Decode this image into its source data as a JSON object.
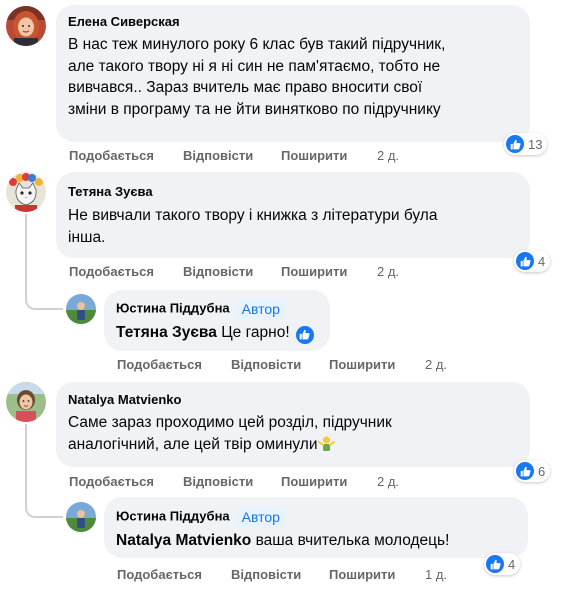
{
  "actions": {
    "like": "Подобається",
    "reply": "Відповісти",
    "share": "Поширити"
  },
  "comments": [
    {
      "author": "Елена Сиверская",
      "lines": [
        "В нас теж минулого року 6 клас був такий підручник,",
        "але такого твору ні я ні син не пам'ятаємо, тобто не",
        "вивчався.. Зараз вчитель має право вносити свої",
        "зміни в програму та не йти винятково по підручнику"
      ],
      "time": "2 д.",
      "reactions": "13",
      "avatar_icon": "user-avatar-woman-red-hair"
    },
    {
      "author": "Тетяна Зуєва",
      "lines": [
        "Не вивчали такого твору і книжка з літератури була",
        "інша."
      ],
      "time": "2 д.",
      "reactions": "4",
      "avatar_icon": "user-avatar-cat-wreath"
    },
    {
      "author": "Natalya Matvienko",
      "lines": [
        "Саме зараз проходимо цей розділ, підручник",
        "аналогічний, але цей твір оминули"
      ],
      "time": "2 д.",
      "reactions": "6",
      "avatar_icon": "user-avatar-woman-outdoor"
    }
  ],
  "replies": [
    {
      "author": "Юстина Піддубна",
      "badge": "Автор",
      "mention": "Тетяна Зуєва",
      "text": "Це гарно!",
      "time": "2 д.",
      "avatar_icon": "user-avatar-outdoor-green"
    },
    {
      "author": "Юстина Піддубна",
      "badge": "Автор",
      "mention": "Natalya Matvienko",
      "text": "ваша вчителька молодець!",
      "time": "1 д.",
      "reactions": "4",
      "avatar_icon": "user-avatar-outdoor-green"
    }
  ],
  "colors": {
    "bubble": "#f0f2f5",
    "like_blue": "#1877f2",
    "muted_text": "#65676b",
    "badge_bg": "#e7f3ff",
    "badge_text": "#1b74e4"
  }
}
